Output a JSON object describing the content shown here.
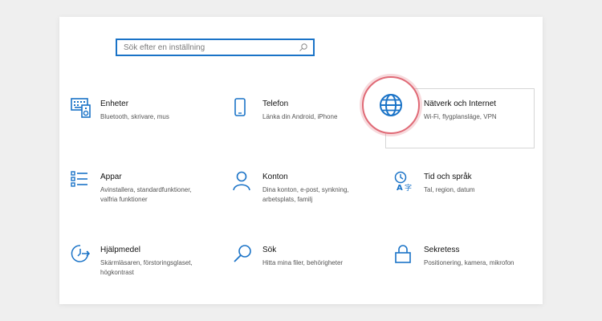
{
  "search": {
    "placeholder": "Sök efter en inställning"
  },
  "items": [
    {
      "title": "Enheter",
      "desc": "Bluetooth, skrivare, mus",
      "icon": "keyboard-icon"
    },
    {
      "title": "Telefon",
      "desc": "Länka din Android, iPhone",
      "icon": "phone-icon"
    },
    {
      "title": "Nätverk och Internet",
      "desc": "Wi-Fi, flygplansläge, VPN",
      "icon": "globe-icon"
    },
    {
      "title": "Appar",
      "desc": "Avinstallera, standardfunktioner, valfria funktioner",
      "icon": "apps-list-icon"
    },
    {
      "title": "Konton",
      "desc": "Dina konton, e-post, synkning, arbetsplats, familj",
      "icon": "person-icon"
    },
    {
      "title": "Tid och språk",
      "desc": "Tal, region, datum",
      "icon": "time-language-icon"
    },
    {
      "title": "Hjälpmedel",
      "desc": "Skärmläsaren, förstoringsglaset, högkontrast",
      "icon": "accessibility-icon"
    },
    {
      "title": "Sök",
      "desc": "Hitta mina filer, behörigheter",
      "icon": "search-magnifier-icon"
    },
    {
      "title": "Sekretess",
      "desc": "Positionering, kamera, mikrofon",
      "icon": "lock-icon"
    }
  ],
  "colors": {
    "accent": "#1a73c7",
    "highlight_ring": "#e06a76",
    "background": "#efefef"
  }
}
